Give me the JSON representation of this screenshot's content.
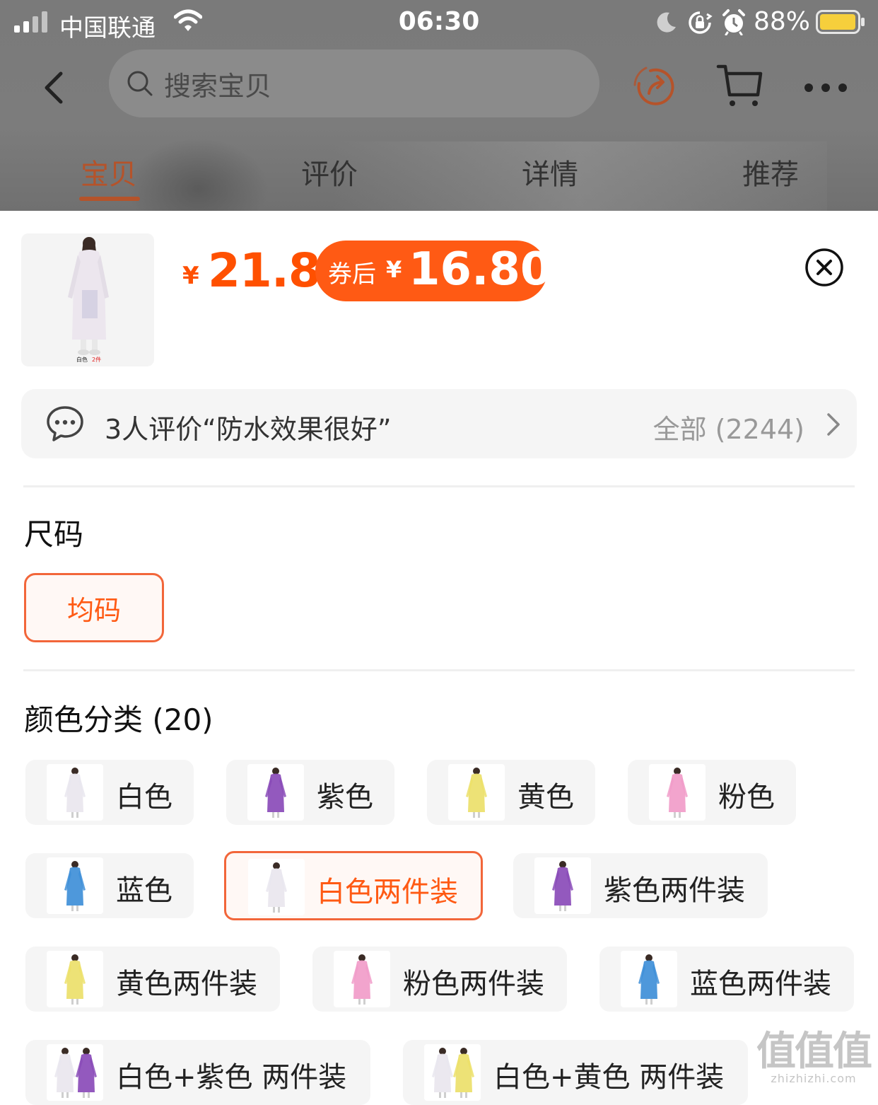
{
  "status_bar": {
    "carrier": "中国联通",
    "time": "06:30",
    "battery_percent": "88%",
    "icons": [
      "signal-icon",
      "wifi-icon",
      "moon-icon",
      "rotation-lock-icon",
      "alarm-icon",
      "battery-icon"
    ]
  },
  "nav": {
    "search_placeholder": "搜索宝贝",
    "icons": [
      "back-icon",
      "search-icon",
      "share-icon",
      "cart-icon",
      "more-icon"
    ]
  },
  "tabs": [
    {
      "label": "宝贝",
      "active": true
    },
    {
      "label": "评价",
      "active": false
    },
    {
      "label": "详情",
      "active": false
    },
    {
      "label": "推荐",
      "active": false
    }
  ],
  "product": {
    "thumb_caption": "白色 2件",
    "price_symbol": "¥",
    "price": "21.8",
    "coupon_label": "券后",
    "coupon_symbol": "¥",
    "coupon_price": "16.80"
  },
  "reviews": {
    "summary": "3人评价“防水效果很好”",
    "all_label": "全部 (2244)"
  },
  "size": {
    "title": "尺码",
    "options": [
      {
        "label": "均码",
        "selected": true
      }
    ]
  },
  "colors": {
    "title": "颜色分类 (20)",
    "options": [
      {
        "label": "白色",
        "selected": false,
        "swatch": "#e9e6ee"
      },
      {
        "label": "紫色",
        "selected": false,
        "swatch": "#8a4bb8"
      },
      {
        "label": "黄色",
        "selected": false,
        "swatch": "#ece06a"
      },
      {
        "label": "粉色",
        "selected": false,
        "swatch": "#f19cc9"
      },
      {
        "label": "蓝色",
        "selected": false,
        "swatch": "#3f8fd8"
      },
      {
        "label": "白色两件装",
        "selected": true,
        "swatch": "#e9e6ee"
      },
      {
        "label": "紫色两件装",
        "selected": false,
        "swatch": "#8a4bb8"
      },
      {
        "label": "黄色两件装",
        "selected": false,
        "swatch": "#ece06a"
      },
      {
        "label": "粉色两件装",
        "selected": false,
        "swatch": "#f19cc9"
      },
      {
        "label": "蓝色两件装",
        "selected": false,
        "swatch": "#3f8fd8"
      },
      {
        "label": "白色+紫色 两件装",
        "selected": false,
        "swatch": "#e9e6ee",
        "swatch2": "#8a4bb8"
      },
      {
        "label": "白色+黄色 两件装",
        "selected": false,
        "swatch": "#e9e6ee",
        "swatch2": "#ece06a"
      }
    ]
  },
  "watermark": {
    "main": "值值值",
    "sub": "zhizhizhi.com"
  },
  "accent_color": "#ff5000"
}
